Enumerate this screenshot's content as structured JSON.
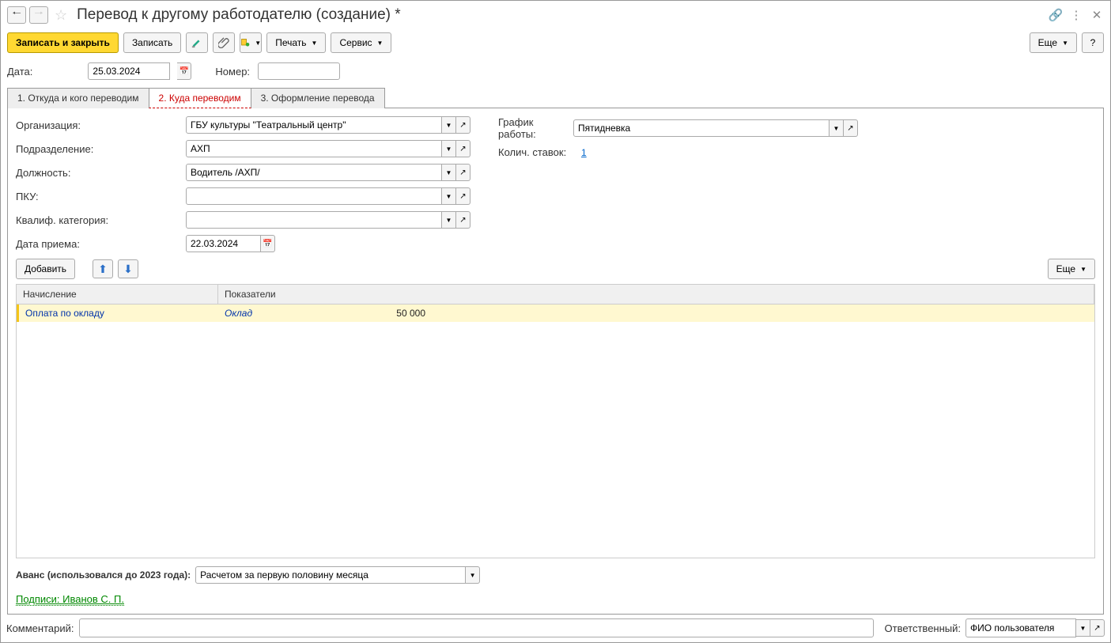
{
  "title": "Перевод к другому работодателю (создание) *",
  "toolbar": {
    "write_close": "Записать и закрыть",
    "write": "Записать",
    "print": "Печать",
    "service": "Сервис",
    "more": "Еще",
    "help": "?"
  },
  "fields": {
    "date_label": "Дата:",
    "date_value": "25.03.2024",
    "number_label": "Номер:",
    "number_value": ""
  },
  "tabs": {
    "t1": "1. Откуда и кого переводим",
    "t2": "2. Куда переводим",
    "t3": "3. Оформление перевода"
  },
  "form": {
    "org_label": "Организация:",
    "org_value": "ГБУ культуры \"Театральный центр\"",
    "dept_label": "Подразделение:",
    "dept_value": "АХП",
    "pos_label": "Должность:",
    "pos_value": "Водитель /АХП/",
    "pku_label": "ПКУ:",
    "pku_value": "",
    "qual_label": "Квалиф. категория:",
    "qual_value": "",
    "hire_label": "Дата приема:",
    "hire_value": "22.03.2024",
    "sched_label": "График работы:",
    "sched_value": "Пятидневка",
    "rates_label": "Колич. ставок:",
    "rates_value": "1"
  },
  "tabletb": {
    "add": "Добавить",
    "more": "Еще"
  },
  "table": {
    "th1": "Начисление",
    "th2": "Показатели",
    "row_name": "Оплата по окладу",
    "row_ind": "Оклад",
    "row_val": "50 000"
  },
  "avans": {
    "label": "Аванс (использовался до 2023 года):",
    "value": "Расчетом за первую половину месяца"
  },
  "sign": "Подписи: Иванов С. П.",
  "footer": {
    "comment_label": "Комментарий:",
    "comment_value": "",
    "resp_label": "Ответственный:",
    "resp_value": "ФИО пользователя"
  }
}
